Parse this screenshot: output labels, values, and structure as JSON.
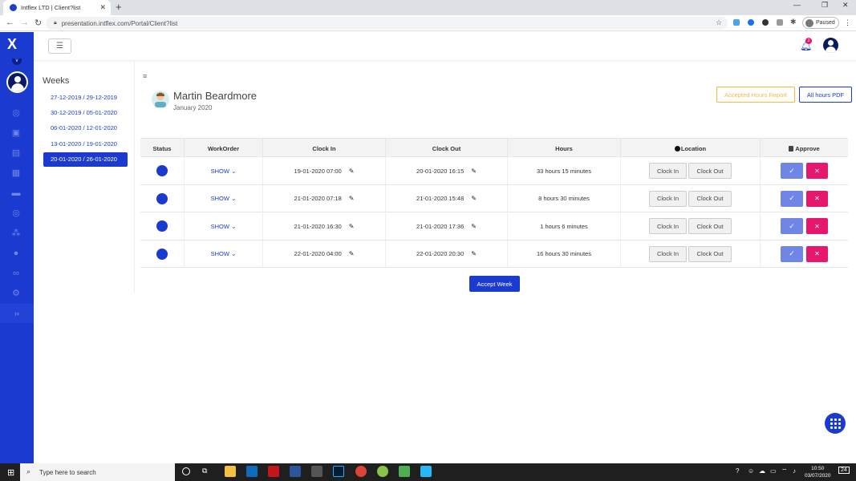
{
  "browser": {
    "tab_title": "Intflex LTD | Client?list",
    "url": "presentation.intflex.com/Portal/Client?list",
    "profile_status": "Paused",
    "new_tab": "+",
    "minimize": "—",
    "restore": "❐",
    "close": "✕"
  },
  "header": {
    "notification_count": "2"
  },
  "weeks": {
    "title": "Weeks",
    "items": [
      {
        "label": "27-12-2019 / 29-12-2019",
        "active": false
      },
      {
        "label": "30-12-2019 / 05-01-2020",
        "active": false
      },
      {
        "label": "06-01-2020 / 12-01-2020",
        "active": false
      },
      {
        "label": "13-01-2020 / 19-01-2020",
        "active": false
      },
      {
        "label": "20-01-2020 / 26-01-2020",
        "active": true
      }
    ]
  },
  "employee": {
    "name": "Martin Beardmore",
    "month": "January 2020"
  },
  "actions": {
    "accepted_report": "Accepted Hours Report",
    "all_pdf": "All hours PDF",
    "accept_week": "Accept Week"
  },
  "table": {
    "headers": {
      "status": "Status",
      "workorder": "WorkOrder",
      "clock_in": "Clock In",
      "clock_out": "Clock Out",
      "hours": "Hours",
      "location": "Location",
      "approve": "Approve"
    },
    "show_label": "SHOW",
    "btn_clock_in": "Clock In",
    "btn_clock_out": "Clock Out",
    "rows": [
      {
        "clock_in": "19-01-2020 07:00",
        "clock_out": "20-01-2020 16:15",
        "hours": "33 hours 15 minutes"
      },
      {
        "clock_in": "21-01-2020 07:18",
        "clock_out": "21-01-2020 15:48",
        "hours": "8 hours 30 minutes"
      },
      {
        "clock_in": "21-01-2020 16:30",
        "clock_out": "21-01-2020 17:36",
        "hours": "1 hours 6 minutes"
      },
      {
        "clock_in": "22-01-2020 04:00",
        "clock_out": "22-01-2020 20:30",
        "hours": "16 hours 30 minutes"
      }
    ]
  },
  "taskbar": {
    "search_placeholder": "Type here to search",
    "time": "10:50",
    "date": "03/07/2020",
    "notifications": "24"
  },
  "colors": {
    "brand": "#1b3acf",
    "accent_warning": "#f5b942",
    "danger": "#e6176c",
    "approve": "#6f86e6"
  }
}
